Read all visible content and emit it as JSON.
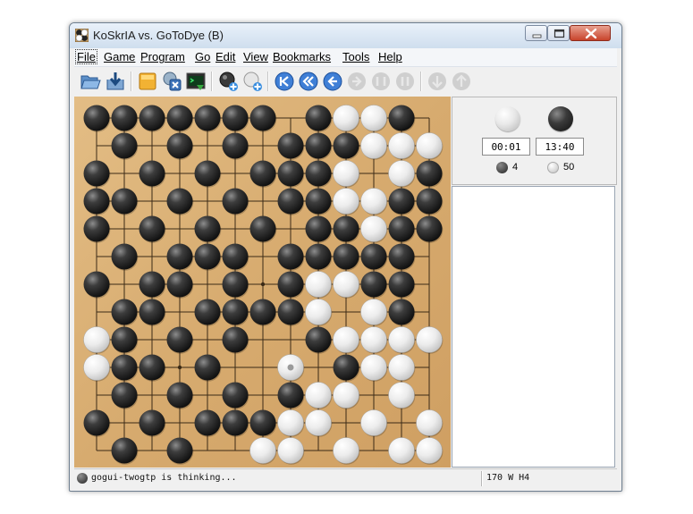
{
  "window": {
    "title": "KoSkrIA vs. GoToDye (B)"
  },
  "menu": [
    "File",
    "Game",
    "Program",
    "Go",
    "Edit",
    "View",
    "Bookmarks",
    "Tools",
    "Help"
  ],
  "menu_active": "File",
  "toolbar": {
    "buttons": [
      {
        "id": "open",
        "icon": "open-folder-icon",
        "enabled": true
      },
      {
        "id": "save",
        "icon": "save-icon",
        "enabled": true
      },
      {
        "id": "new-game",
        "icon": "new-game-icon",
        "enabled": true
      },
      {
        "id": "detach",
        "icon": "detach-program-icon",
        "enabled": true
      },
      {
        "id": "gtp-shell",
        "icon": "gtp-shell-icon",
        "enabled": true
      },
      {
        "id": "play",
        "icon": "play-icon",
        "enabled": true
      },
      {
        "id": "play-single",
        "icon": "play-single-icon",
        "enabled": true
      },
      {
        "id": "beginning",
        "icon": "go-beginning-icon",
        "enabled": true
      },
      {
        "id": "back-ten",
        "icon": "back-ten-icon",
        "enabled": true
      },
      {
        "id": "back",
        "icon": "back-icon",
        "enabled": true
      },
      {
        "id": "forward",
        "icon": "forward-icon",
        "enabled": false
      },
      {
        "id": "forward-ten",
        "icon": "forward-ten-icon",
        "enabled": false
      },
      {
        "id": "end",
        "icon": "go-end-icon",
        "enabled": false
      },
      {
        "id": "previous-variation",
        "icon": "previous-variation-icon",
        "enabled": false
      },
      {
        "id": "next-variation",
        "icon": "next-variation-icon",
        "enabled": false
      }
    ]
  },
  "board": {
    "size": 13,
    "last_move": "H4",
    "rows": [
      "BBBBBBB.BWWB.",
      ".B.B.B.BBBWWW",
      "B.B.B.BBBW.WB",
      "BB.B.B.BBWWBB",
      "B.B.B.B.BBWBB",
      ".B.BBB.BBBBB.",
      "B.BB.B.BWWBB.",
      ".BB.BBBBW.WB.",
      "WB.B.B..BWWWW",
      "WBB.B..W.BWW.W",
      ".B.B.B.BWW.W.",
      "B.B.BBBWW.W.W",
      ".B.B..WW.W.WW"
    ]
  },
  "clocks": {
    "white_time": "00:01",
    "black_time": "13:40"
  },
  "captures": {
    "black": "4",
    "white": "50"
  },
  "status": {
    "message": "gogui-twogtp is thinking...",
    "move_info": "170 W H4"
  },
  "colors": {
    "board": "#dcb27a",
    "grid": "#3b2a16",
    "black_stone": "#222222",
    "white_stone": "#f4f4f4"
  }
}
